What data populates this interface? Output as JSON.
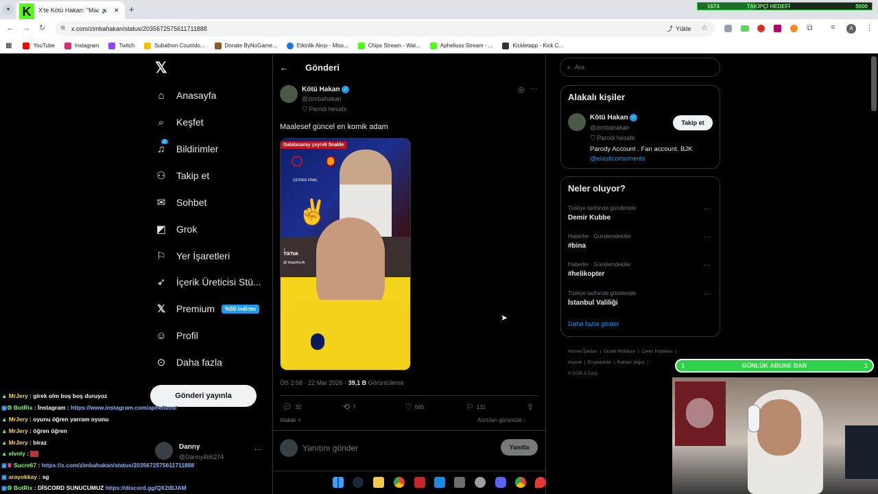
{
  "browser": {
    "tab_title": "X'te Kötü Hakan: \"Maal...",
    "url": "x.com/zimbahakan/status/2035672575611711888",
    "upload_label": "Yükle",
    "bookmarks": [
      "YouTube",
      "Instagram",
      "Twitch",
      "Subathon Countdo...",
      "Donate ByNoGame...",
      "Etkinlik Akışı - Miss...",
      "Chips Stream - Wat...",
      "Apheliuss Stream - ...",
      "Kickletapp - Kick C..."
    ],
    "profile_initial": "A"
  },
  "overlay": {
    "follower_count": "1674",
    "follower_goal_label": "TAKİPÇİ HEDEFİ",
    "follower_goal": "5000",
    "sub_bar_label": "GÜNLÜK ABUNE BAR",
    "sub_left": "1",
    "sub_right": "1"
  },
  "sidebar": {
    "items": [
      {
        "label": "Anasayfa",
        "icon": "home-icon"
      },
      {
        "label": "Keşfet",
        "icon": "search-icon"
      },
      {
        "label": "Bildirimler",
        "icon": "bell-icon",
        "badge": "2"
      },
      {
        "label": "Takip et",
        "icon": "person-add-icon"
      },
      {
        "label": "Sohbet",
        "icon": "mail-icon"
      },
      {
        "label": "Grok",
        "icon": "grok-icon"
      },
      {
        "label": "Yer İşaretleri",
        "icon": "bookmark-icon"
      },
      {
        "label": "İçerik Üreticisi Stü...",
        "icon": "rocket-icon"
      },
      {
        "label": "Premium",
        "icon": "x-icon",
        "badge": "%50 indirim"
      },
      {
        "label": "Profil",
        "icon": "profile-icon"
      },
      {
        "label": "Daha fazla",
        "icon": "more-circle-icon"
      }
    ],
    "post_button": "Gönderi yayınla",
    "account_name": "Danny",
    "account_handle": "@Danny466274"
  },
  "post": {
    "header": "Gönderi",
    "author_name": "Kötü Hakan",
    "author_handle": "@zimbahakan",
    "parody_label": "Parodi hesabı",
    "text": "Maalesef güncel en komik adam",
    "media_caption": "Galatasaray çeyrek finalde",
    "media_tiktok": "TikTok",
    "media_tiktok_handle": "@ doganka.lik",
    "media_match_label": "ÇEYREK FİNAL",
    "time": "ÖS 1:58 · 22 Mar 2026 · ",
    "views": "39,1 B",
    "views_label": " Görüntüleme",
    "replies": "32",
    "reposts": "7",
    "likes": "665",
    "bookmarks": "131",
    "relevant_label": "Alakalı",
    "quotes_label": "Alıntıları görüntüle",
    "reply_placeholder": "Yanıtını gönder",
    "reply_button": "Yanıtla"
  },
  "right": {
    "search_placeholder": "Ara",
    "people_title": "Alakalı kişiler",
    "person_name": "Kötü Hakan",
    "person_handle": "@zimbahakan",
    "person_parody": "Parodi hesabı",
    "person_bio": "Parody Account . Fan account. BJK",
    "person_link": "@elasticomoments",
    "follow_button": "Takip et",
    "trends_title": "Neler oluyor?",
    "trends": [
      {
        "meta": "Türkiye tarihinde gündemde",
        "topic": "Demir Kubbe"
      },
      {
        "meta": "Haberler · Gündemdekiler",
        "topic": "#bina"
      },
      {
        "meta": "Haberler · Gündemdekiler",
        "topic": "#helikopter"
      },
      {
        "meta": "Türkiye tarihinde gündemde",
        "topic": "İstanbul Valiliği"
      }
    ],
    "show_more": "Daha fazla göster",
    "footer_1": [
      "Hizmet Şartları",
      "Gizlilik Politikası",
      "Çerez Politikası"
    ],
    "footer_2": [
      "Imprint",
      "Erişilebilirlik",
      "Reklam bilgisi"
    ],
    "copyright": "© 2026 X Corp."
  },
  "chat": [
    {
      "user": "MrJery",
      "msg": "girek olm boş boş duruyoz"
    },
    {
      "user": "BotRix",
      "msg": "İnstagram : ",
      "link": "https://www.instagram.com/apheliuss/"
    },
    {
      "user": "MrJery",
      "msg": "oyunu öğren yarram oyunu"
    },
    {
      "user": "MrJery",
      "msg": "öğren öğren"
    },
    {
      "user": "MrJery",
      "msg": "biraz"
    },
    {
      "user": "elvnly",
      "msg": ""
    },
    {
      "user": "Sucre67",
      "msg": "",
      "link": "https://x.com/zimbahakan/status/2035672575611711888"
    },
    {
      "user": "arayokkay",
      "msg": "sg"
    },
    {
      "user": "BotRix",
      "msg": "DİSCORD SUNUCUMUZ ",
      "link": "https://discord.gg/QX2tBJAM"
    }
  ],
  "colors": {
    "accent": "#1d9bf0",
    "overlay_green": "#2fd14a",
    "kick_green": "#53fc18"
  }
}
